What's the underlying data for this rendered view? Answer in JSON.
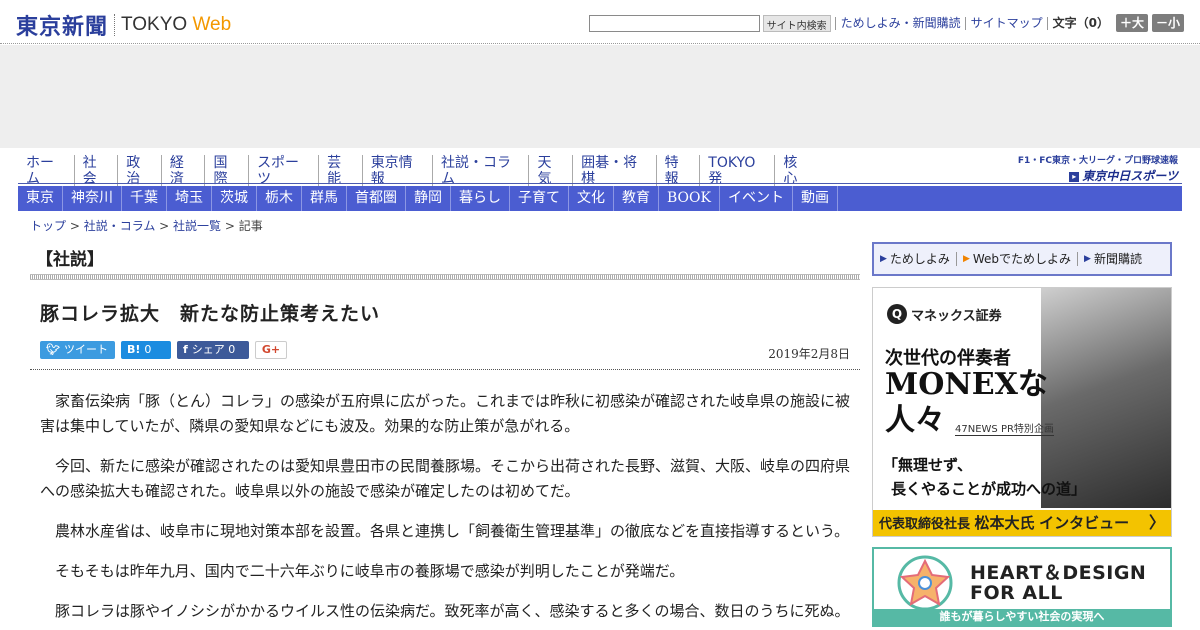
{
  "header": {
    "logo_jp": "東京新聞",
    "logo_en": "TOKYO",
    "logo_web": "Web",
    "search_placeholder": "",
    "search_button": "サイト内検索",
    "links": [
      "ためしよみ・新聞購読",
      "サイトマップ"
    ],
    "font_label": "文字（0）",
    "font_plus": "＋大",
    "font_minus": "－小"
  },
  "nav_primary": [
    "ホーム",
    "社会",
    "政治",
    "経済",
    "国際",
    "スポーツ",
    "芸能",
    "東京情報",
    "社説・コラム",
    "天気",
    "囲碁・将棋",
    "特報",
    "TOKYO発",
    "核心"
  ],
  "chunichi": {
    "line1": "F1・FC東京・大リーグ・プロ野球速報",
    "line2": "東京中日スポーツ"
  },
  "nav_secondary": [
    "東京",
    "神奈川",
    "千葉",
    "埼玉",
    "茨城",
    "栃木",
    "群馬",
    "首都圏",
    "静岡",
    "暮らし",
    "子育て",
    "文化",
    "教育",
    "BOOK",
    "イベント",
    "動画"
  ],
  "breadcrumb": {
    "items": [
      "トップ",
      "社説・コラム",
      "社説一覧"
    ],
    "current": "記事",
    "separator": " > "
  },
  "article": {
    "section": "【社説】",
    "headline": "豚コレラ拡大　新たな防止策考えたい",
    "date": "2019年2月8日",
    "share": {
      "tweet": "ツイート",
      "hatena_icon": "B!",
      "hatena_count": "0",
      "facebook_label": "シェア",
      "facebook_count": "0",
      "gplus": "G+"
    },
    "paragraphs": [
      "家畜伝染病「豚（とん）コレラ」の感染が五府県に広がった。これまでは昨秋に初感染が確認された岐阜県の施設に被害は集中していたが、隣県の愛知県などにも波及。効果的な防止策が急がれる。",
      "今回、新たに感染が確認されたのは愛知県豊田市の民間養豚場。そこから出荷された長野、滋賀、大阪、岐阜の四府県への感染拡大も確認された。岐阜県以外の施設で感染が確定したのは初めてだ。",
      "農林水産省は、岐阜市に現地対策本部を設置。各県と連携し「飼養衛生管理基準」の徹底などを直接指導するという。",
      "そもそもは昨年九月、国内で二十六年ぶりに岐阜市の養豚場で感染が判明したことが発端だ。",
      "豚コレラは豚やイノシシがかかるウイルス性の伝染病だ。致死率が高く、感染すると多くの場合、数日のうちに死ぬ。"
    ]
  },
  "sidebar": {
    "subscribe": [
      "ためしよみ",
      "Webでためしよみ",
      "新聞購読"
    ],
    "monex_ad": {
      "brand": "マネックス証券",
      "line1": "次世代の伴奏者",
      "line2": "MONEXな",
      "line3": "人々",
      "pr": "47NEWS PR特別企画",
      "quote1": "「無理せず、",
      "quote2": "長くやることが成功への道」",
      "bar_prefix": "代表取締役社長",
      "bar_name": "松本大氏",
      "bar_suffix": "インタビュー"
    },
    "heart_ad": {
      "line1": "HEART＆DESIGN",
      "line2": "FOR ALL",
      "tagline": "誰もが暮らしやすい社会の実現へ"
    }
  },
  "colors": {
    "brand_blue": "#2b3f9c",
    "nav_bar": "#4b5dd1",
    "accent_orange": "#f39800",
    "monex_yellow": "#f3c300",
    "heart_teal": "#56b9a5"
  }
}
